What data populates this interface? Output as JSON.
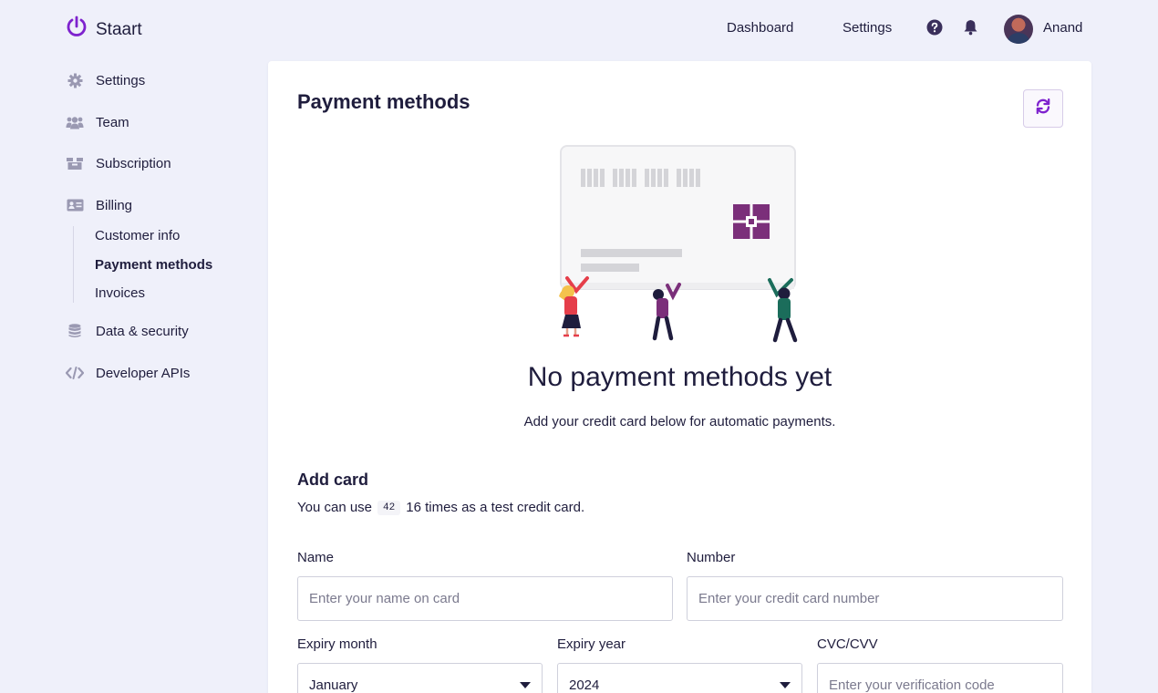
{
  "brand": {
    "name": "Staart",
    "accent": "#7e22ce"
  },
  "topnav": {
    "links": [
      "Dashboard",
      "Settings"
    ],
    "user_name": "Anand"
  },
  "sidebar": {
    "items": [
      {
        "label": "Settings",
        "icon": "gear-icon"
      },
      {
        "label": "Team",
        "icon": "users-icon"
      },
      {
        "label": "Subscription",
        "icon": "box-icon"
      },
      {
        "label": "Billing",
        "icon": "id-card-icon"
      },
      {
        "label": "Data & security",
        "icon": "database-icon"
      },
      {
        "label": "Developer APIs",
        "icon": "code-icon"
      }
    ],
    "billing_sub": [
      "Customer info",
      "Payment methods",
      "Invoices"
    ]
  },
  "main": {
    "title": "Payment methods",
    "empty_title": "No payment methods yet",
    "empty_subtitle": "Add your credit card below for automatic payments.",
    "add_card_title": "Add card",
    "test_note_before": "You can use",
    "test_code": "42",
    "test_note_after": "16 times as a test credit card.",
    "form": {
      "name_label": "Name",
      "name_placeholder": "Enter your name on card",
      "number_label": "Number",
      "number_placeholder": "Enter your credit card number",
      "month_label": "Expiry month",
      "month_value": "January",
      "year_label": "Expiry year",
      "year_value": "2024",
      "cvc_label": "CVC/CVV",
      "cvc_placeholder": "Enter your verification code"
    }
  }
}
